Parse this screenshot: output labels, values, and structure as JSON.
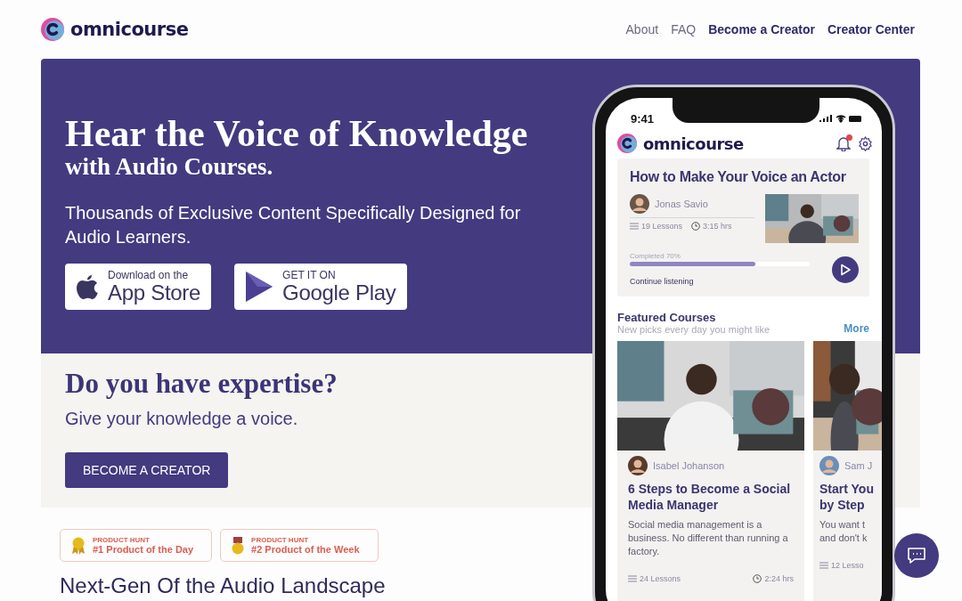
{
  "header": {
    "logo": "omnicourse",
    "nav": [
      {
        "label": "About",
        "bold": false
      },
      {
        "label": "FAQ",
        "bold": false
      },
      {
        "label": "Become a Creator",
        "bold": true
      },
      {
        "label": "Creator Center",
        "bold": true
      }
    ]
  },
  "hero": {
    "title": "Hear the Voice of Knowledge",
    "subtitle": "with Audio Courses.",
    "tagline": "Thousands of Exclusive Content Specifically Designed for Audio Learners.",
    "stores": [
      {
        "kind": "apple",
        "small": "Download on the",
        "big": "App Store"
      },
      {
        "kind": "google",
        "small": "GET IT ON",
        "big": "Google Play"
      }
    ]
  },
  "creator": {
    "title": "Do you have expertise?",
    "text": "Give your knowledge a voice.",
    "button": "BECOME A CREATOR"
  },
  "awards": [
    {
      "kind": "ribbon",
      "source": "PRODUCT HUNT",
      "label": "#1 Product of the Day"
    },
    {
      "kind": "medal",
      "source": "PRODUCT HUNT",
      "label": "#2 Product of the Week"
    }
  ],
  "next_heading": "Next-Gen Of the Audio Landscape",
  "phone": {
    "time": "9:41",
    "logo": "omnicourse",
    "current": {
      "title": "How to Make Your Voice an Actor",
      "author": "Jonas Savio",
      "lessons": "19 Lessons",
      "duration": "3:15 hrs",
      "progress_label": "Completed 70%",
      "level": 0.7,
      "action": "Continue listening"
    },
    "featured": {
      "title": "Featured Courses",
      "subtitle": "New picks every day you might like",
      "more": "More",
      "courses": [
        {
          "author": "Isabel Johanson",
          "title": "6 Steps to Become a Social Media Manager",
          "text": "Social media management is a business. No different than running a factory.",
          "lessons": "24 Lessons",
          "duration": "2:24 hrs"
        },
        {
          "author": "Sam J",
          "title": "Start You\nby Step",
          "text": "You want t\nand don't k",
          "lessons": "12 Lesso"
        }
      ]
    }
  }
}
